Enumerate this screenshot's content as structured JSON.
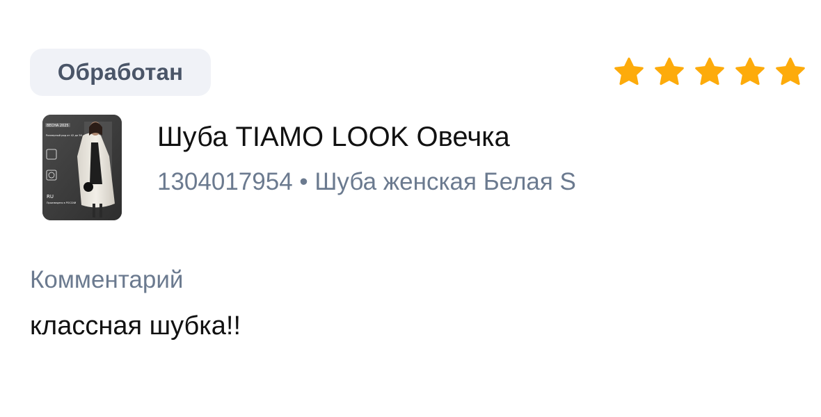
{
  "review": {
    "status": "Обработан",
    "rating": 5,
    "rating_max": 5,
    "star_color": "#fdab0b",
    "product": {
      "title": "Шуба TIAMO LOOK Овечка",
      "meta": "1304017954 • Шуба женская Белая S",
      "image_overlay": {
        "season": "ВЕСНА 2025",
        "sizes": "Размерный ряд от 42 до 56",
        "country_code": "RU",
        "country_label": "Произведено в РОССИИ"
      }
    },
    "comment_label": "Комментарий",
    "comment_text": "классная шубка!!"
  }
}
